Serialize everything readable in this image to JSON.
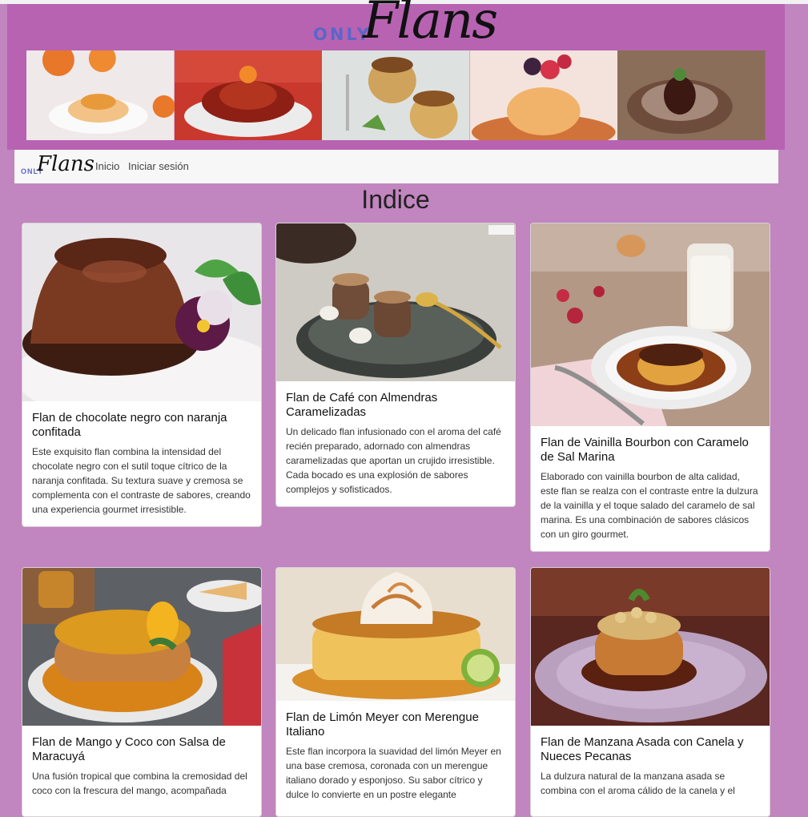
{
  "banner": {
    "logo_prefix": "ONLY",
    "logo_name": "Flans"
  },
  "navbar": {
    "logo_prefix": "ONLY",
    "logo_name": "Flans",
    "links": [
      "Inicio",
      "Iniciar sesión"
    ]
  },
  "page": {
    "title": "Indice"
  },
  "cards": [
    {
      "title": "Flan de chocolate negro con naranja confitada",
      "text": "Este exquisito flan combina la intensidad del chocolate negro con el sutil toque cítrico de la naranja confitada. Su textura suave y cremosa se complementa con el contraste de sabores, creando una experiencia gourmet irresistible."
    },
    {
      "title": "Flan de Café con Almendras Caramelizadas",
      "text": "Un delicado flan infusionado con el aroma del café recién preparado, adornado con almendras caramelizadas que aportan un crujido irresistible. Cada bocado es una explosión de sabores complejos y sofisticados."
    },
    {
      "title": "Flan de Vainilla Bourbon con Caramelo de Sal Marina",
      "text": "Elaborado con vainilla bourbon de alta calidad, este flan se realza con el contraste entre la dulzura de la vainilla y el toque salado del caramelo de sal marina. Es una combinación de sabores clásicos con un giro gourmet."
    },
    {
      "title": "Flan de Mango y Coco con Salsa de Maracuyá",
      "text": "Una fusión tropical que combina la cremosidad del coco con la frescura del mango, acompañada"
    },
    {
      "title": "Flan de Limón Meyer con Merengue Italiano",
      "text": "Este flan incorpora la suavidad del limón Meyer en una base cremosa, coronada con un merengue italiano dorado y esponjoso. Su sabor cítrico y dulce lo convierte en un postre elegante"
    },
    {
      "title": "Flan de Manzana Asada con Canela y Nueces Pecanas",
      "text": "La dulzura natural de la manzana asada se combina con el aroma cálido de la canela y el"
    }
  ]
}
